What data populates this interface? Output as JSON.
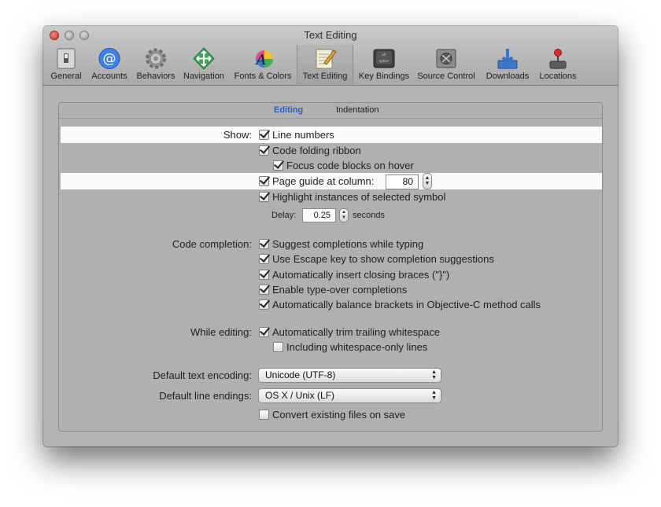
{
  "window": {
    "title": "Text Editing"
  },
  "toolbar": {
    "items": [
      {
        "label": "General"
      },
      {
        "label": "Accounts"
      },
      {
        "label": "Behaviors"
      },
      {
        "label": "Navigation"
      },
      {
        "label": "Fonts & Colors"
      },
      {
        "label": "Text Editing"
      },
      {
        "label": "Key Bindings"
      },
      {
        "label": "Source Control"
      },
      {
        "label": "Downloads"
      },
      {
        "label": "Locations"
      }
    ],
    "selected": "Text Editing"
  },
  "tabs": [
    {
      "label": "Editing",
      "active": true
    },
    {
      "label": "Indentation",
      "active": false
    }
  ],
  "show": {
    "label": "Show:",
    "line_numbers": {
      "label": "Line numbers",
      "checked": true
    },
    "code_folding": {
      "label": "Code folding ribbon",
      "checked": true
    },
    "focus_blocks": {
      "label": "Focus code blocks on hover",
      "checked": true
    },
    "page_guide": {
      "label": "Page guide at column:",
      "checked": true,
      "value": "80"
    },
    "highlight": {
      "label": "Highlight instances of selected symbol",
      "checked": true
    },
    "delay": {
      "label": "Delay:",
      "value": "0.25",
      "unit": "seconds"
    }
  },
  "code_completion": {
    "label": "Code completion:",
    "items": [
      {
        "label": "Suggest completions while typing",
        "checked": true
      },
      {
        "label": "Use Escape key to show completion suggestions",
        "checked": true
      },
      {
        "label": "Automatically insert closing braces (\"}\")",
        "checked": true
      },
      {
        "label": "Enable type-over completions",
        "checked": true
      },
      {
        "label": "Automatically balance brackets in Objective-C method calls",
        "checked": true
      }
    ]
  },
  "while_editing": {
    "label": "While editing:",
    "trim": {
      "label": "Automatically trim trailing whitespace",
      "checked": true
    },
    "whitespace_only": {
      "label": "Including whitespace-only lines",
      "checked": false
    }
  },
  "encoding": {
    "label": "Default text encoding:",
    "value": "Unicode (UTF-8)"
  },
  "line_endings": {
    "label": "Default line endings:",
    "value": "OS X / Unix (LF)"
  },
  "convert": {
    "label": "Convert existing files on save",
    "checked": false
  },
  "colors": {
    "accent": "#2b62c2",
    "highlight_row": "#fafafa",
    "window_bg": "#b4b4b4"
  }
}
